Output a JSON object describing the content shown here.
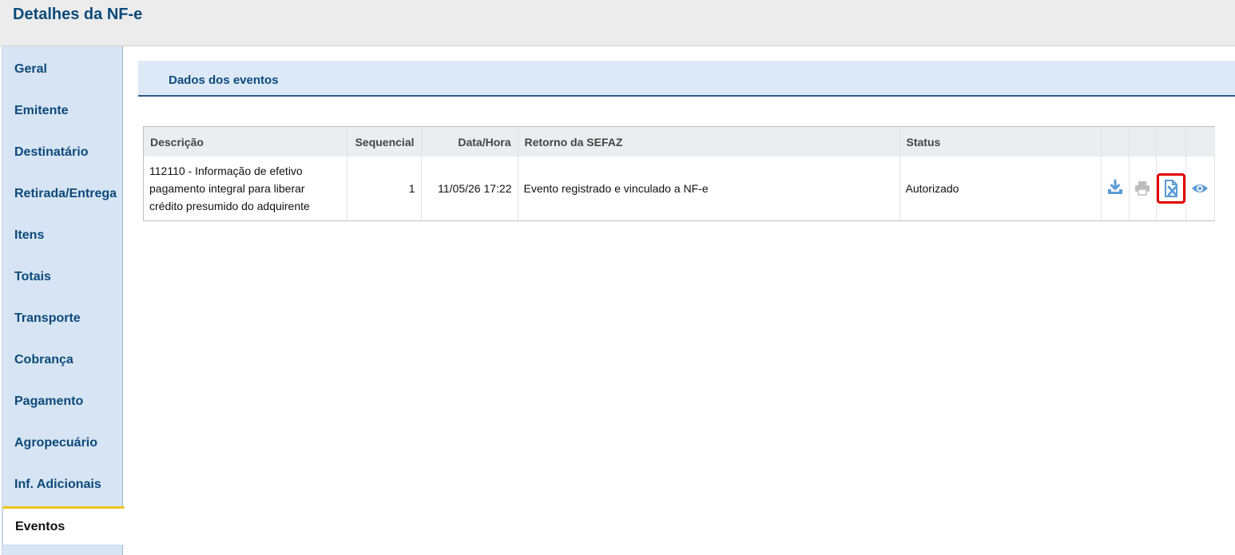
{
  "header": {
    "title": "Detalhes da NF-e"
  },
  "sidebar": {
    "items": [
      {
        "label": "Geral"
      },
      {
        "label": "Emitente"
      },
      {
        "label": "Destinatário"
      },
      {
        "label": "Retirada/Entrega"
      },
      {
        "label": "Itens"
      },
      {
        "label": "Totais"
      },
      {
        "label": "Transporte"
      },
      {
        "label": "Cobrança"
      },
      {
        "label": "Pagamento"
      },
      {
        "label": "Agropecuário"
      },
      {
        "label": "Inf. Adicionais"
      },
      {
        "label": "Eventos",
        "active": true
      }
    ]
  },
  "section": {
    "title": "Dados dos eventos"
  },
  "events_table": {
    "columns": [
      "Descrição",
      "Sequencial",
      "Data/Hora",
      "Retorno da SEFAZ",
      "Status"
    ],
    "rows": [
      {
        "descricao": "112110 - Informação de efetivo pagamento integral para liberar crédito presumido do adquirente",
        "sequencial": "1",
        "data_hora": "11/05/26 17:22",
        "retorno": "Evento registrado e vinculado a NF-e",
        "status": "Autorizado",
        "actions": [
          "download-icon",
          "print-icon",
          "cancel-document-icon",
          "view-icon"
        ]
      }
    ]
  },
  "colors": {
    "brand": "#0b4a7a",
    "sidebar_bg": "#d7e4f3",
    "active_accent": "#f0c419",
    "icon_blue": "#5b9bd5",
    "highlight": "#e00000"
  }
}
